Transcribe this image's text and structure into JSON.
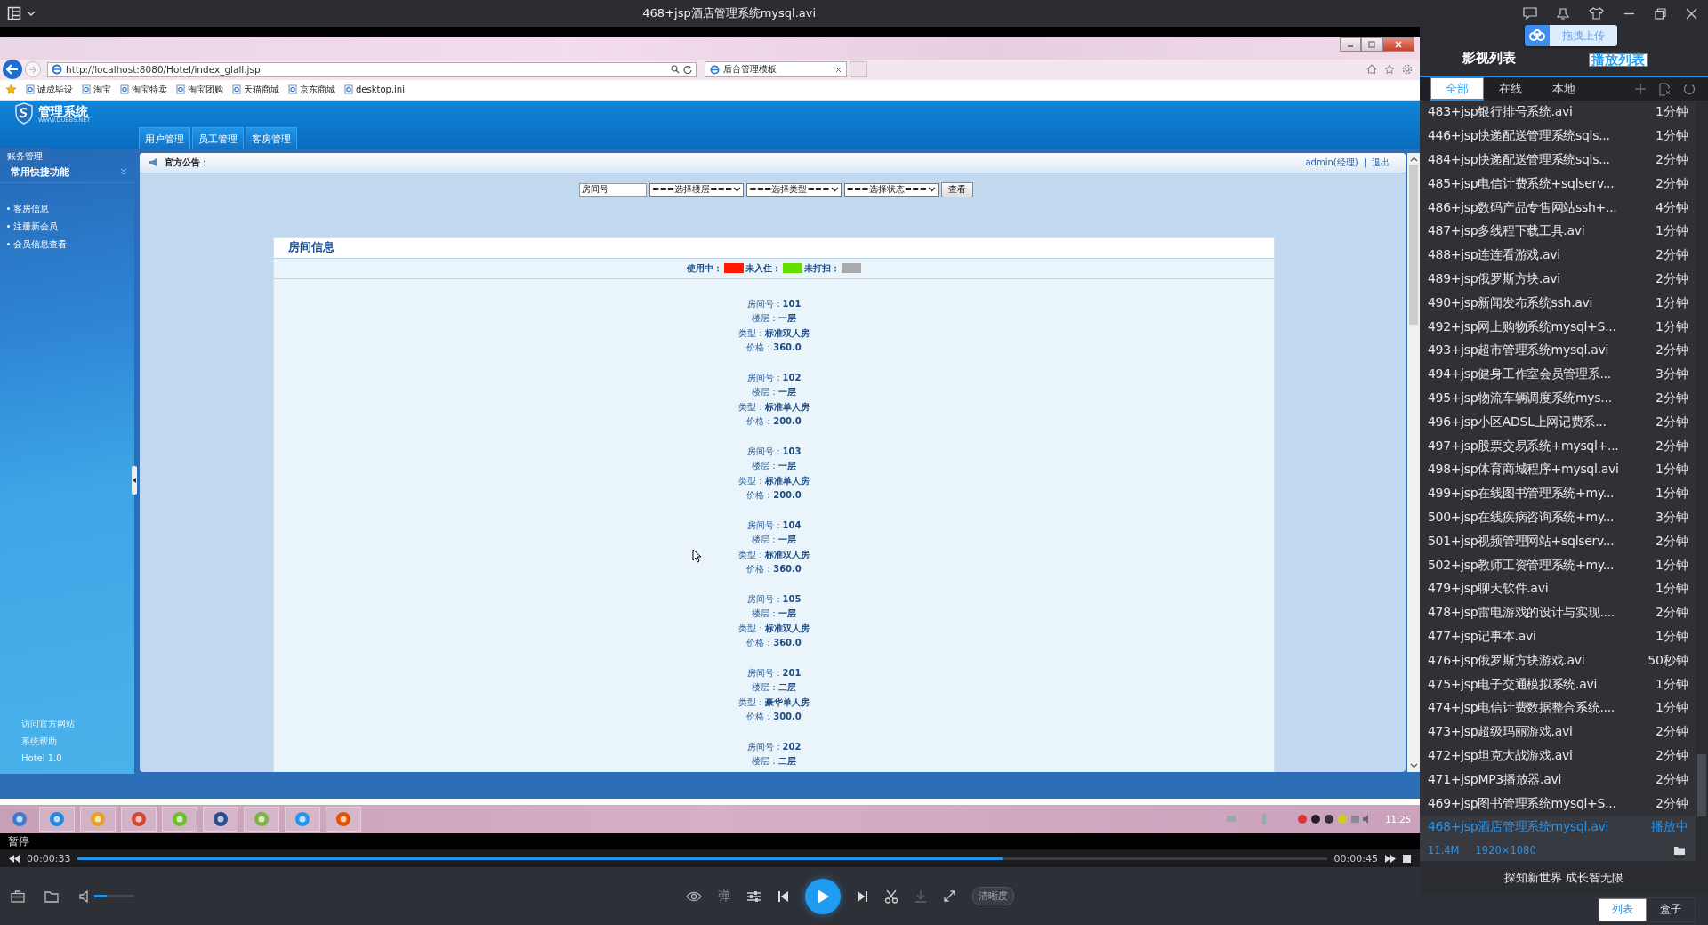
{
  "player": {
    "title": "468+jsp酒店管理系统mysql.avi",
    "status": "暂停",
    "playing": false,
    "elapsed": "00:00:33",
    "total": "00:00:45",
    "progress": {
      "level": 0.74
    },
    "volume": {
      "level": 0.32
    },
    "danmaku": "弹",
    "quality": "清晰度"
  },
  "screen": {
    "browser": {
      "url": "http://localhost:8080/Hotel/index_glall.jsp",
      "tab": "后台管理模板",
      "bookmarks": [
        "诚成毕设",
        "淘宝",
        "淘宝特卖",
        "淘宝团购",
        "天猫商城",
        "京东商城",
        "desktop.ini"
      ]
    },
    "app": {
      "logo": "管理系统",
      "logo_domain": "WWW.DUBBS.NET",
      "nav": [
        "用户管理",
        "员工管理",
        "客房管理"
      ],
      "sidebar": {
        "section": "账务管理",
        "group": "常用快捷功能",
        "items": [
          "客房信息",
          "注册新会员",
          "会员信息查看"
        ],
        "footer": [
          "访问官方网站",
          "系统帮助",
          "Hotel 1.0"
        ]
      },
      "notice_label": "官方公告：",
      "user": "admin(经理)",
      "separator": "|",
      "logout": "退出",
      "filters": {
        "room_value": "房间号",
        "selects": [
          "===选择楼层===",
          "===选择类型===",
          "===选择状态==="
        ],
        "button": "查看"
      },
      "panel_title": "房间信息",
      "legend": [
        {
          "label": "使用中：",
          "color": "#ff1a00"
        },
        {
          "label": "未入住：",
          "color": "#66dd00"
        },
        {
          "label": "未打扫：",
          "color": "#aaaaaa"
        }
      ],
      "rooms": [
        {
          "fields": [
            {
              "label": "房间号：",
              "value": "101"
            },
            {
              "label": "楼层：",
              "value": "一层"
            },
            {
              "label": "类型：",
              "value": "标准双人房"
            },
            {
              "label": "价格：",
              "value": "360.0"
            }
          ]
        },
        {
          "fields": [
            {
              "label": "房间号：",
              "value": "102"
            },
            {
              "label": "楼层：",
              "value": "一层"
            },
            {
              "label": "类型：",
              "value": "标准单人房"
            },
            {
              "label": "价格：",
              "value": "200.0"
            }
          ]
        },
        {
          "fields": [
            {
              "label": "房间号：",
              "value": "103"
            },
            {
              "label": "楼层：",
              "value": "一层"
            },
            {
              "label": "类型：",
              "value": "标准单人房"
            },
            {
              "label": "价格：",
              "value": "200.0"
            }
          ]
        },
        {
          "fields": [
            {
              "label": "房间号：",
              "value": "104"
            },
            {
              "label": "楼层：",
              "value": "一层"
            },
            {
              "label": "类型：",
              "value": "标准双人房"
            },
            {
              "label": "价格：",
              "value": "360.0"
            }
          ]
        },
        {
          "fields": [
            {
              "label": "房间号：",
              "value": "105"
            },
            {
              "label": "楼层：",
              "value": "一层"
            },
            {
              "label": "类型：",
              "value": "标准双人房"
            },
            {
              "label": "价格：",
              "value": "360.0"
            }
          ]
        },
        {
          "fields": [
            {
              "label": "房间号：",
              "value": "201"
            },
            {
              "label": "楼层：",
              "value": "二层"
            },
            {
              "label": "类型：",
              "value": "豪华单人房"
            },
            {
              "label": "价格：",
              "value": "300.0"
            }
          ]
        },
        {
          "fields": [
            {
              "label": "房间号：",
              "value": "202"
            },
            {
              "label": "楼层：",
              "value": "二层"
            }
          ]
        }
      ]
    },
    "taskbar": {
      "clock": "11:25"
    }
  },
  "playlist": {
    "tabs": [
      {
        "label": "影视列表",
        "selected": false
      },
      {
        "label": "播放列表",
        "selected": true
      }
    ],
    "upload": "拖拽上传",
    "filters": [
      {
        "label": "全部",
        "selected": true
      },
      {
        "label": "在线",
        "selected": false
      },
      {
        "label": "本地",
        "selected": false
      }
    ],
    "items": [
      {
        "title": "483+jsp银行排号系统.avi",
        "duration": "1分钟",
        "playing": false
      },
      {
        "title": "446+jsp快递配送管理系统sqls...",
        "duration": "1分钟",
        "playing": false
      },
      {
        "title": "484+jsp快递配送管理系统sqls...",
        "duration": "2分钟",
        "playing": false
      },
      {
        "title": "485+jsp电信计费系统+sqlserv...",
        "duration": "2分钟",
        "playing": false
      },
      {
        "title": "486+jsp数码产品专售网站ssh+...",
        "duration": "4分钟",
        "playing": false
      },
      {
        "title": "487+jsp多线程下载工具.avi",
        "duration": "1分钟",
        "playing": false
      },
      {
        "title": "488+jsp连连看游戏.avi",
        "duration": "2分钟",
        "playing": false
      },
      {
        "title": "489+jsp俄罗斯方块.avi",
        "duration": "2分钟",
        "playing": false
      },
      {
        "title": "490+jsp新闻发布系统ssh.avi",
        "duration": "1分钟",
        "playing": false
      },
      {
        "title": "492+jsp网上购物系统mysql+S...",
        "duration": "1分钟",
        "playing": false
      },
      {
        "title": "493+jsp超市管理系统mysql.avi",
        "duration": "2分钟",
        "playing": false
      },
      {
        "title": "494+jsp健身工作室会员管理系...",
        "duration": "3分钟",
        "playing": false
      },
      {
        "title": "495+jsp物流车辆调度系统mys...",
        "duration": "2分钟",
        "playing": false
      },
      {
        "title": "496+jsp小区ADSL上网记费系...",
        "duration": "2分钟",
        "playing": false
      },
      {
        "title": "497+jsp股票交易系统+mysql+...",
        "duration": "2分钟",
        "playing": false
      },
      {
        "title": "498+jsp体育商城程序+mysql.avi",
        "duration": "1分钟",
        "playing": false
      },
      {
        "title": "499+jsp在线图书管理系统+my...",
        "duration": "1分钟",
        "playing": false
      },
      {
        "title": "500+jsp在线疾病咨询系统+my...",
        "duration": "3分钟",
        "playing": false
      },
      {
        "title": "501+jsp视频管理网站+sqlserv...",
        "duration": "2分钟",
        "playing": false
      },
      {
        "title": "502+jsp教师工资管理系统+my...",
        "duration": "1分钟",
        "playing": false
      },
      {
        "title": "479+jsp聊天软件.avi",
        "duration": "1分钟",
        "playing": false
      },
      {
        "title": "478+jsp雷电游戏的设计与实现....",
        "duration": "2分钟",
        "playing": false
      },
      {
        "title": "477+jsp记事本.avi",
        "duration": "1分钟",
        "playing": false
      },
      {
        "title": "476+jsp俄罗斯方块游戏.avi",
        "duration": "50秒钟",
        "playing": false
      },
      {
        "title": "475+jsp电子交通模拟系统.avi",
        "duration": "1分钟",
        "playing": false
      },
      {
        "title": "474+jsp电信计费数据整合系统....",
        "duration": "1分钟",
        "playing": false
      },
      {
        "title": "473+jsp超级玛丽游戏.avi",
        "duration": "2分钟",
        "playing": false
      },
      {
        "title": "472+jsp坦克大战游戏.avi",
        "duration": "2分钟",
        "playing": false
      },
      {
        "title": "471+jspMP3播放器.avi",
        "duration": "2分钟",
        "playing": false
      },
      {
        "title": "469+jsp图书管理系统mysql+S...",
        "duration": "2分钟",
        "playing": false
      },
      {
        "title": "468+jsp酒店管理系统mysql.avi",
        "duration": "播放中",
        "playing": true
      }
    ],
    "info": {
      "size": "11.4M",
      "resolution": "1920×1080"
    },
    "slogan": "探知新世界 成长智无限",
    "views": [
      {
        "label": "列表",
        "selected": true
      },
      {
        "label": "盒子",
        "selected": false
      }
    ]
  }
}
